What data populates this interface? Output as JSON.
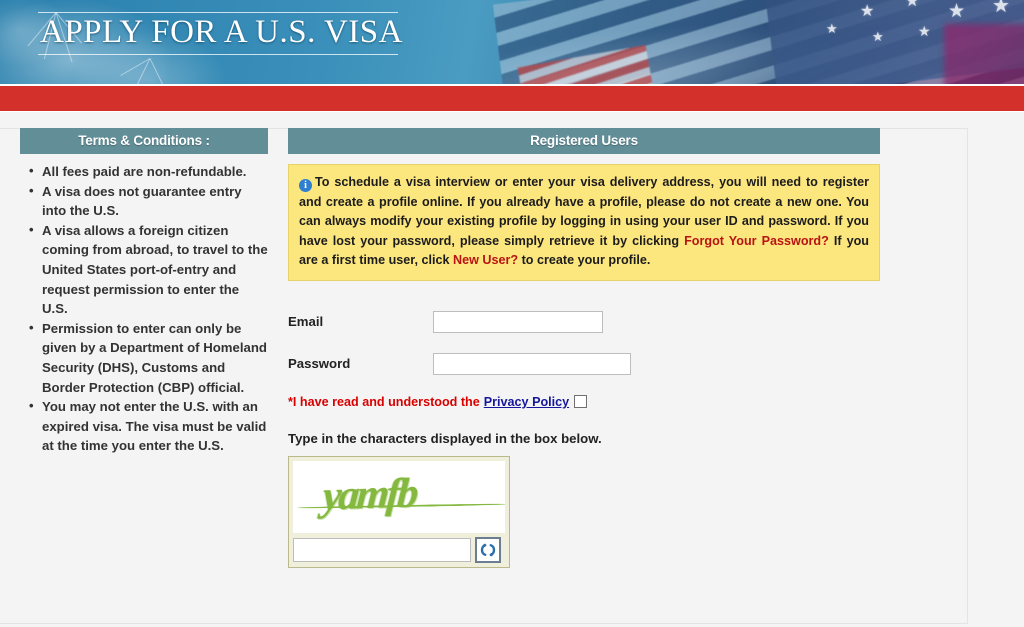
{
  "banner": {
    "title": "APPLY FOR A U.S. VISA",
    "flag_alt": "us-flag"
  },
  "colors": {
    "red_stripe": "#d3302c",
    "panel_heading": "#618e97",
    "info_box_bg": "#fce67e",
    "red_link": "#b81414",
    "privacy_text": "#d90000",
    "privacy_link": "#16169c",
    "captcha_green": "#84b83f"
  },
  "terms_panel": {
    "heading": "Terms & Conditions :",
    "items": [
      "All fees paid are non-refundable.",
      "A visa does not guarantee entry into the U.S.",
      "A visa allows a foreign citizen coming from abroad, to travel to the United States port-of-entry and request permission to enter the U.S.",
      "Permission to enter can only be given by a Department of Homeland Security (DHS), Customs and Border Protection (CBP) official.",
      "You may not enter the U.S. with an expired visa. The visa must be valid at the time you enter the U.S."
    ]
  },
  "registered_users": {
    "heading": "Registered Users",
    "info": {
      "icon": "info-icon",
      "part1": "To schedule a visa interview or enter your visa delivery address, you will need to register and create a profile online. If you already have a profile, please do not create a new one. You can always modify your existing profile by logging in using your user ID and password. If you have lost your password, please simply retrieve it by clicking ",
      "forgot_link": "Forgot Your Password?",
      "part2": " If you are a first time user, click ",
      "new_user_link": "New User?",
      "part3": " to create your profile."
    },
    "form": {
      "email_label": "Email",
      "email_value": "",
      "email_placeholder": "",
      "password_label": "Password",
      "password_value": "",
      "password_placeholder": "",
      "privacy_prefix": "*I have read and understood the",
      "privacy_link": "Privacy Policy",
      "privacy_checked": false
    },
    "captcha": {
      "prompt": "Type in the characters displayed in the box below.",
      "text": "yamfb",
      "input_value": "",
      "input_placeholder": "",
      "refresh_label": "refresh-icon"
    }
  }
}
